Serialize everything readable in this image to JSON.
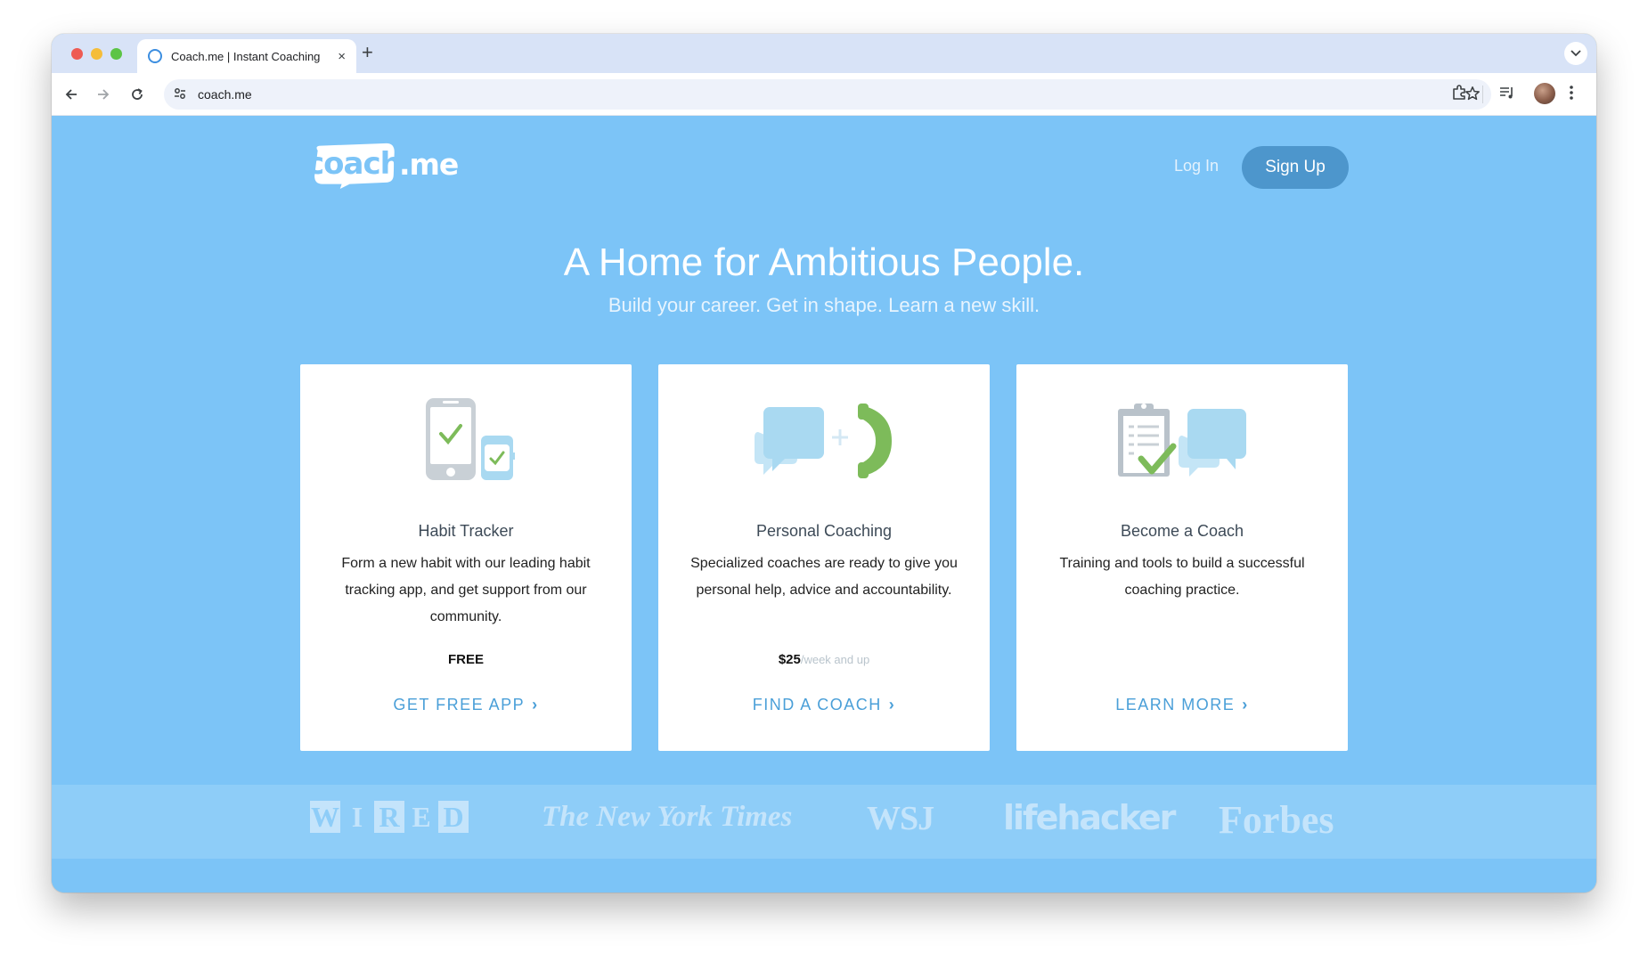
{
  "browser": {
    "tab_title": "Coach.me | Instant Coaching",
    "tab_close": "×",
    "new_tab": "+",
    "url": "coach.me"
  },
  "header": {
    "logo_main": "coach",
    "logo_suffix": ".me",
    "login": "Log In",
    "signup": "Sign Up"
  },
  "hero": {
    "headline": "A Home for Ambitious People.",
    "subline": "Build your career. Get in shape. Learn a new skill."
  },
  "cards": [
    {
      "title": "Habit Tracker",
      "description": "Form a new habit with our leading habit tracking app, and get support from our community.",
      "price": "FREE",
      "price_suffix": "",
      "cta": "GET FREE APP",
      "icon": "phone-watch-check-icon"
    },
    {
      "title": "Personal Coaching",
      "description": "Specialized coaches are ready to give you personal help, advice and accountability.",
      "price": "$25",
      "price_suffix": "/week and up",
      "cta": "FIND A COACH",
      "icon": "chat-plus-phone-icon"
    },
    {
      "title": "Become a Coach",
      "description": "Training and tools to build a successful coaching practice.",
      "price": "",
      "price_suffix": "",
      "cta": "LEARN MORE",
      "icon": "clipboard-chat-icon"
    }
  ],
  "press": {
    "wired": [
      "W",
      "I",
      "R",
      "E",
      "D"
    ],
    "nyt": "The New York Times",
    "wsj": "WSJ",
    "lifehacker": "lifehacker",
    "forbes": "Forbes"
  },
  "colors": {
    "page_bg": "#7cc4f7",
    "accent": "#4a9fd8",
    "signup_bg": "#4d96cc",
    "check_green": "#7dbb5a"
  }
}
